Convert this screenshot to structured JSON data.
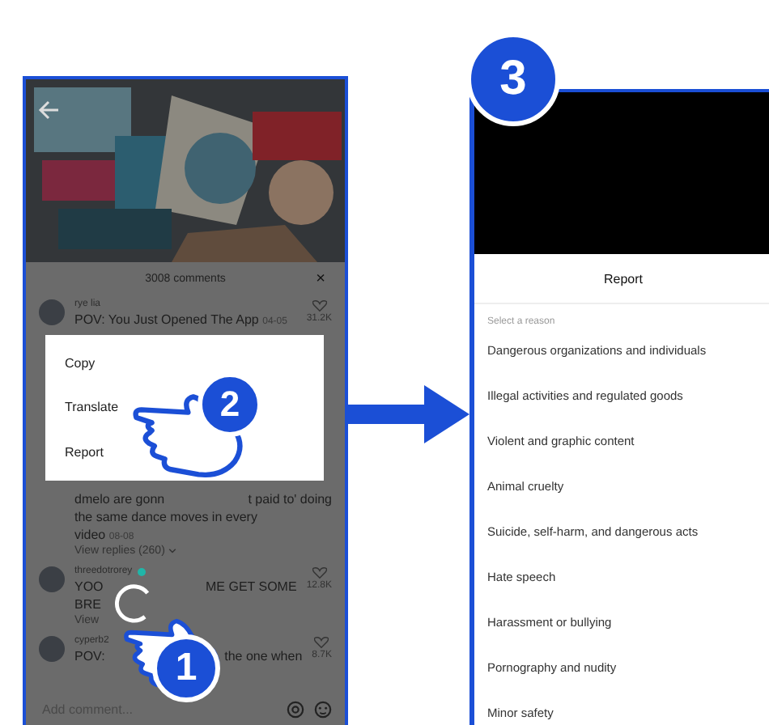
{
  "left_screen": {
    "comments_title": "3008 comments",
    "close": "×",
    "comments": [
      {
        "user": "rye lia",
        "verified": false,
        "lines": [
          [
            "POV: You Just Opened The App"
          ]
        ],
        "time": "04-05",
        "likes": "31.2K"
      },
      {
        "verified": false,
        "lines": [
          [
            "dmelo are gonn",
            "t paid to' doing"
          ],
          [
            "the same dance moves in every"
          ],
          [
            "video"
          ]
        ],
        "time": "08-08",
        "replies": "View replies (260)"
      },
      {
        "user": "threedotrorey",
        "verified": true,
        "lines": [
          [
            "YOO",
            "ME GET SOME"
          ],
          [
            "BRE"
          ]
        ],
        "likes": "12.8K",
        "replies": "View"
      },
      {
        "user": "cyperb2",
        "verified": false,
        "lines": [
          [
            "POV:",
            "the one when"
          ]
        ],
        "likes": "8.7K"
      }
    ],
    "menu": [
      "Copy",
      "Translate",
      "Report"
    ],
    "add_comment": {
      "placeholder": "Add comment..."
    }
  },
  "step_badges": [
    "1",
    "2",
    "3"
  ],
  "right_screen": {
    "title": "Report",
    "section": "Select a reason",
    "reasons": [
      "Dangerous organizations and individuals",
      "Illegal activities and regulated goods",
      "Violent and graphic content",
      "Animal cruelty",
      "Suicide, self-harm, and dangerous acts",
      "Hate speech",
      "Harassment or bullying",
      "Pornography and nudity",
      "Minor safety"
    ]
  }
}
